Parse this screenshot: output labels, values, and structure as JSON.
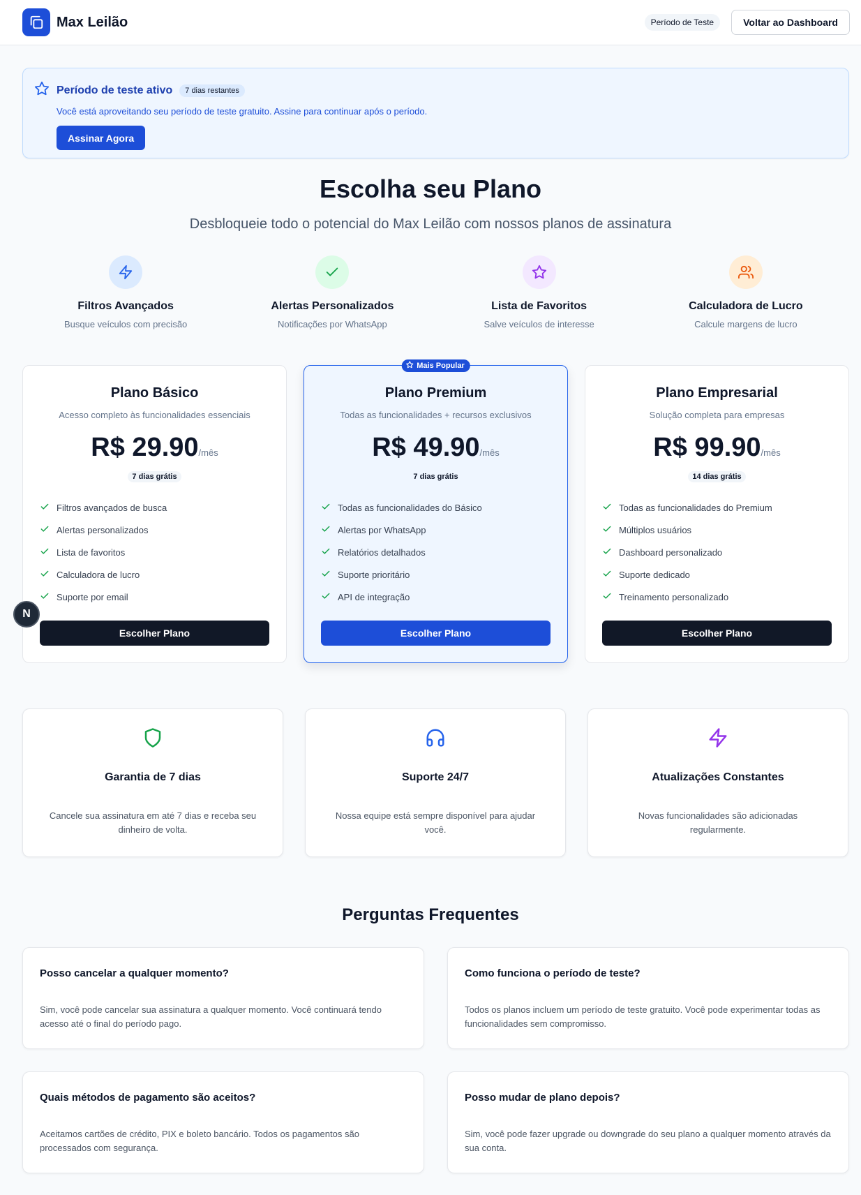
{
  "header": {
    "brand_name": "Max Leilão",
    "trial_badge": "Período de Teste",
    "dashboard_button": "Voltar ao Dashboard"
  },
  "banner": {
    "title": "Período de teste ativo",
    "days_badge": "7 dias restantes",
    "text": "Você está aproveitando seu período de teste gratuito. Assine para continuar após o período.",
    "button": "Assinar Agora"
  },
  "hero": {
    "title": "Escolha seu Plano",
    "subtitle": "Desbloqueie todo o potencial do Max Leilão com nossos planos de assinatura"
  },
  "features": [
    {
      "title": "Filtros Avançados",
      "desc": "Busque veículos com precisão",
      "icon": "lightning-icon",
      "color": "#2563eb",
      "bg": "#dbeafe"
    },
    {
      "title": "Alertas Personalizados",
      "desc": "Notificações por WhatsApp",
      "icon": "check-icon",
      "color": "#16a34a",
      "bg": "#dcfce7"
    },
    {
      "title": "Lista de Favoritos",
      "desc": "Salve veículos de interesse",
      "icon": "star-icon",
      "color": "#9333ea",
      "bg": "#f3e8ff"
    },
    {
      "title": "Calculadora de Lucro",
      "desc": "Calcule margens de lucro",
      "icon": "users-icon",
      "color": "#ea580c",
      "bg": "#ffedd5"
    }
  ],
  "plans": [
    {
      "name": "Plano Básico",
      "desc": "Acesso completo às funcionalidades essenciais",
      "price": "R$ 29.90",
      "period": "/mês",
      "trial": "7 dias grátis",
      "features": [
        "Filtros avançados de busca",
        "Alertas personalizados",
        "Lista de favoritos",
        "Calculadora de lucro",
        "Suporte por email"
      ],
      "button": "Escolher Plano"
    },
    {
      "name": "Plano Premium",
      "badge": "Mais Popular",
      "desc": "Todas as funcionalidades + recursos exclusivos",
      "price": "R$ 49.90",
      "period": "/mês",
      "trial": "7 dias grátis",
      "features": [
        "Todas as funcionalidades do Básico",
        "Alertas por WhatsApp",
        "Relatórios detalhados",
        "Suporte prioritário",
        "API de integração"
      ],
      "button": "Escolher Plano"
    },
    {
      "name": "Plano Empresarial",
      "desc": "Solução completa para empresas",
      "price": "R$ 99.90",
      "period": "/mês",
      "trial": "14 dias grátis",
      "features": [
        "Todas as funcionalidades do Premium",
        "Múltiplos usuários",
        "Dashboard personalizado",
        "Suporte dedicado",
        "Treinamento personalizado"
      ],
      "button": "Escolher Plano"
    }
  ],
  "dev_badge": "N",
  "benefits": [
    {
      "title": "Garantia de 7 dias",
      "desc": "Cancele sua assinatura em até 7 dias e receba seu dinheiro de volta.",
      "icon": "shield-icon",
      "color": "#16a34a"
    },
    {
      "title": "Suporte 24/7",
      "desc": "Nossa equipe está sempre disponível para ajudar você.",
      "icon": "headphones-icon",
      "color": "#2563eb"
    },
    {
      "title": "Atualizações Constantes",
      "desc": "Novas funcionalidades são adicionadas regularmente.",
      "icon": "lightning-icon",
      "color": "#9333ea"
    }
  ],
  "faq": {
    "title": "Perguntas Frequentes",
    "items": [
      {
        "q": "Posso cancelar a qualquer momento?",
        "a": "Sim, você pode cancelar sua assinatura a qualquer momento. Você continuará tendo acesso até o final do período pago."
      },
      {
        "q": "Como funciona o período de teste?",
        "a": "Todos os planos incluem um período de teste gratuito. Você pode experimentar todas as funcionalidades sem compromisso."
      },
      {
        "q": "Quais métodos de pagamento são aceitos?",
        "a": "Aceitamos cartões de crédito, PIX e boleto bancário. Todos os pagamentos são processados com segurança."
      },
      {
        "q": "Posso mudar de plano depois?",
        "a": "Sim, você pode fazer upgrade ou downgrade do seu plano a qualquer momento através da sua conta."
      }
    ]
  }
}
